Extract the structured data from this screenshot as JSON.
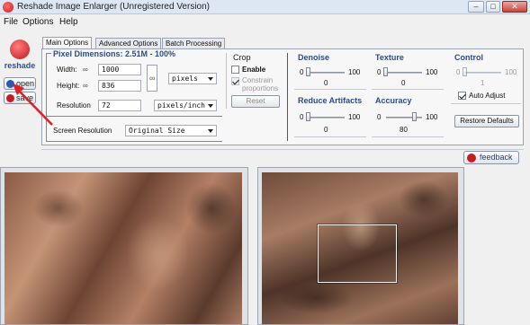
{
  "window": {
    "title": "Reshade Image Enlarger (Unregistered Version)",
    "minimize": "–",
    "maximize": "□",
    "close": "✕"
  },
  "menu": {
    "file": "File",
    "options": "Options",
    "help": "Help"
  },
  "sidebar": {
    "logo_text": "reshade",
    "open_label": "open",
    "save_label": "save"
  },
  "tabs": {
    "main": "Main Options",
    "advanced": "Advanced Options",
    "batch": "Batch Processing"
  },
  "pixel_dimensions": {
    "title": "Pixel Dimensions:  2.51M - 100%",
    "width_label": "Width:",
    "width_value": "1000",
    "height_label": "Height:",
    "height_value": "836",
    "unit": "pixels",
    "resolution_label": "Resolution",
    "resolution_value": "72",
    "resolution_unit": "pixels/inch",
    "screen_resolution_label": "Screen Resolution",
    "screen_resolution_value": "Original Size"
  },
  "crop": {
    "title": "Crop",
    "enable_label": "Enable",
    "enable_checked": false,
    "constrain_label_1": "Constrain",
    "constrain_label_2": "proportions",
    "reset_label": "Reset"
  },
  "denoise": {
    "title": "Denoise",
    "min": "0",
    "max": "100",
    "value": "0",
    "level": 0
  },
  "texture": {
    "title": "Texture",
    "min": "0",
    "max": "100",
    "value": "0",
    "level": 0
  },
  "control": {
    "title": "Control",
    "min": "0",
    "max": "100",
    "value": "1",
    "auto_adjust_label": "Auto Adjust",
    "auto_adjust_checked": true,
    "level": 0.01
  },
  "reduce_artifacts": {
    "title": "Reduce Artifacts",
    "min": "0",
    "max": "100",
    "value": "0",
    "level": 0
  },
  "accuracy": {
    "title": "Accuracy",
    "min": "0",
    "max": "100",
    "value": "80",
    "level": 0.8
  },
  "restore_defaults_label": "Restore Defaults",
  "feedback_label": "feedback",
  "colors": {
    "accent": "#2e4b86",
    "logo_red": "#c51d22",
    "annotation_red": "#e02020"
  },
  "icons": {
    "app": "reshade-logo-icon",
    "open": "folder-open-icon",
    "save": "disk-save-icon",
    "link": "chain-link-icon",
    "feedback": "feedback-icon"
  }
}
